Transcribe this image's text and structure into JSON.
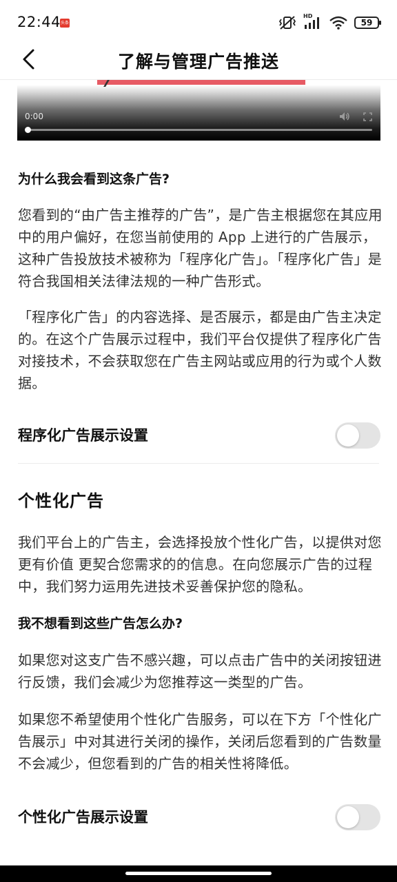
{
  "status_bar": {
    "time": "22:44",
    "app_badge": "头条",
    "network": "HD",
    "battery": "59"
  },
  "header": {
    "title": "了解与管理广告推送"
  },
  "video": {
    "current_time": "0:00",
    "progress": 0
  },
  "section_why": {
    "heading": "为什么我会看到这条广告?",
    "paragraph1": "您看到的“由广告主推荐的广告”，是广告主根据您在其应用中的用户偏好，在您当前使用的 App 上进行的广告展示，这种广告投放技术被称为「程序化广告」。「程序化广告」是符合我国相关法律法规的一种广告形式。",
    "paragraph2": "「程序化广告」的内容选择、是否展示，都是由广告主决定的。在这个广告展示过程中，我们平台仅提供了程序化广告对接技术，不会获取您在广告主网站或应用的行为或个人数据。"
  },
  "programmatic_setting": {
    "label": "程序化广告展示设置",
    "enabled": false
  },
  "section_personalized": {
    "heading": "个性化广告",
    "paragraph": "我们平台上的广告主，会选择投放个性化广告，以提供对您更有价值 更契合您需求的的信息。在向您展示广告的过程中，我们努力运用先进技术妥善保护您的隐私。",
    "subheading": "我不想看到这些广告怎么办?",
    "paragraph2": "如果您对这支广告不感兴趣，可以点击广告中的关闭按钮进行反馈，我们会减少为您推荐这一类型的广告。",
    "paragraph3": "如果您不希望使用个性化广告服务，可以在下方「个性化广告展示」中对其进行关闭的操作，关闭后您看到的广告数量不会减少，但您看到的广告的相关性将降低。"
  },
  "personalized_setting": {
    "label": "个性化广告展示设置",
    "enabled": false
  },
  "colors": {
    "accent_red": "#e75a64",
    "toggle_off": "#e4e4e4"
  }
}
